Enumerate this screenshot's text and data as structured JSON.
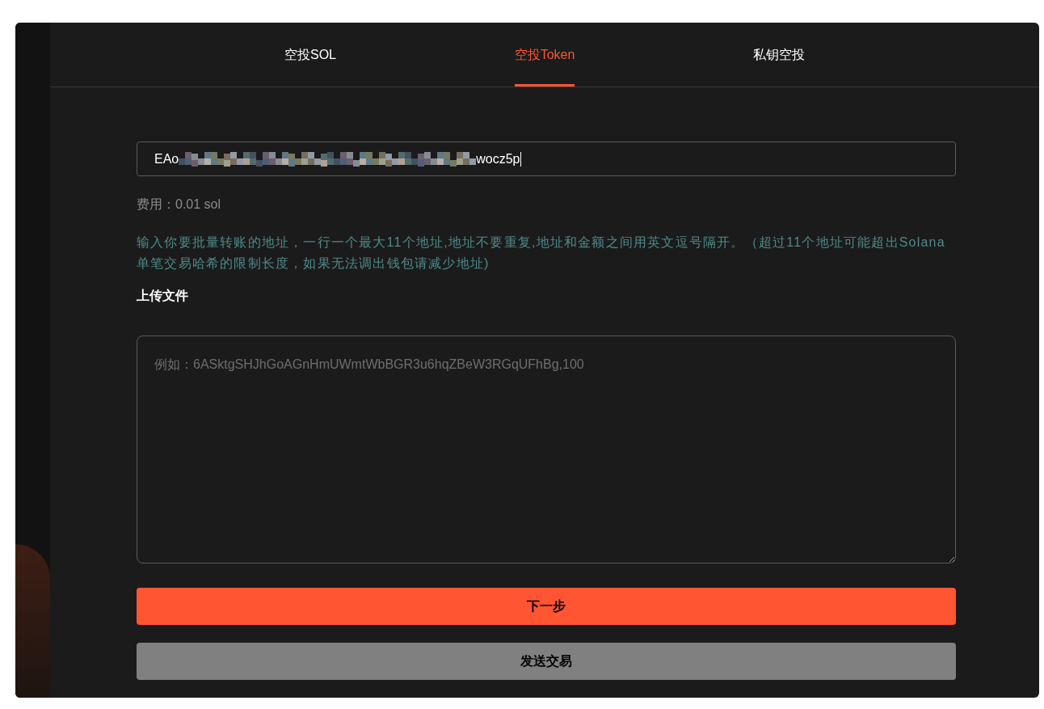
{
  "tabs": [
    {
      "label": "空投SOL",
      "selected": false
    },
    {
      "label": "空投Token",
      "selected": true
    },
    {
      "label": "私钥空投",
      "selected": false
    }
  ],
  "address_field": {
    "value_start": "EAo",
    "redacted": true,
    "value_end": "wocz5p",
    "focused": true
  },
  "fee": "费用：0.01 sol",
  "instructions": "输入你要批量转账的地址，一行一个最大11个地址,地址不要重复,地址和金额之间用英文逗号隔开。（超过11个地址可能超出Solana单笔交易哈希的限制长度，如果无法调出钱包请减少地址)",
  "upload_label": "上传文件",
  "list_field": {
    "placeholder": "例如：6ASktgSHJhGoAGnHmUWmtWbBGR3u6hqZBeW3RGqUFhBg,100"
  },
  "buttons": [
    {
      "label": "下一步",
      "kind": "primary"
    },
    {
      "label": "发送交易",
      "kind": "secondary"
    }
  ]
}
